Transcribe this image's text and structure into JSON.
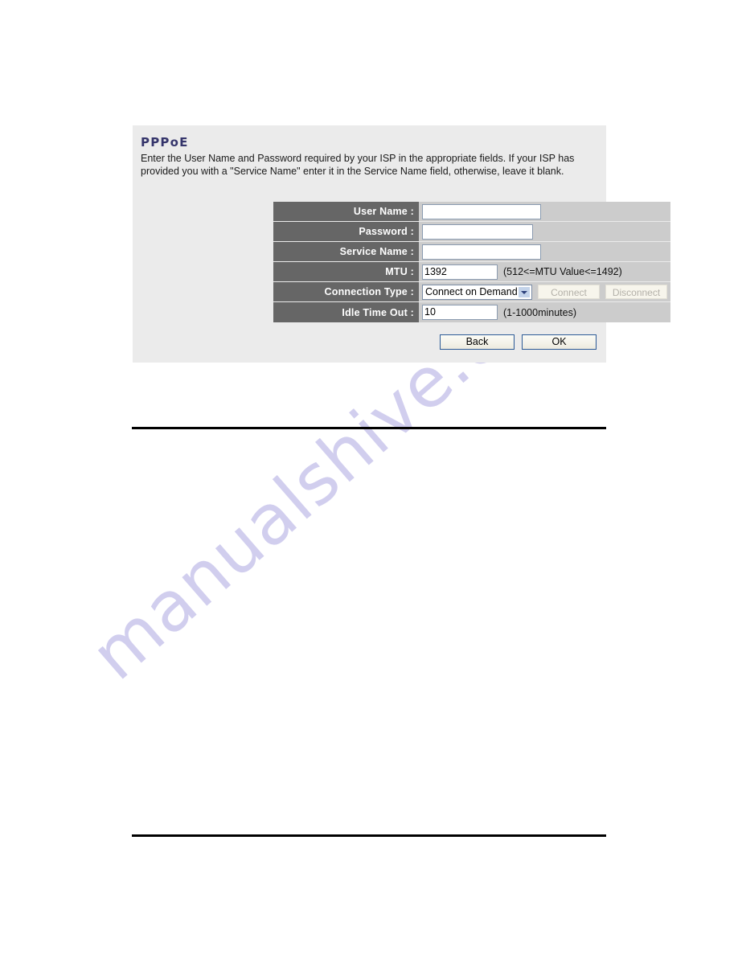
{
  "watermark": {
    "text": "manualshive.com"
  },
  "panel": {
    "title": "PPPoE",
    "description": "Enter the User Name and Password required by your ISP in the appropriate fields. If your ISP has provided you with a \"Service Name\" enter it in the Service Name field, otherwise, leave it blank."
  },
  "form": {
    "rows": [
      {
        "label": "User Name :",
        "value": "",
        "placeholder": "",
        "hint": ""
      },
      {
        "label": "Password :",
        "value": "",
        "placeholder": "",
        "hint": ""
      },
      {
        "label": "Service Name :",
        "value": "",
        "placeholder": "",
        "hint": ""
      },
      {
        "label": "MTU :",
        "value": "1392",
        "placeholder": "",
        "hint": "(512<=MTU Value<=1492)"
      },
      {
        "label": "Connection Type :",
        "value": "Connect on Demand",
        "placeholder": "",
        "hint": ""
      },
      {
        "label": "Idle Time Out :",
        "value": "10",
        "placeholder": "",
        "hint": "(1-1000minutes)"
      }
    ]
  },
  "connection": {
    "selected_type": "Connect on Demand",
    "connect_label": "Connect",
    "disconnect_label": "Disconnect"
  },
  "footer": {
    "back_label": "Back",
    "ok_label": "OK"
  },
  "colors": {
    "panel_background": "#ebebeb",
    "label_column": "#666666",
    "value_column": "#cccccc",
    "title": "#35356b",
    "button_border": "#2c5a96",
    "watermark": "#c9c6ec"
  }
}
